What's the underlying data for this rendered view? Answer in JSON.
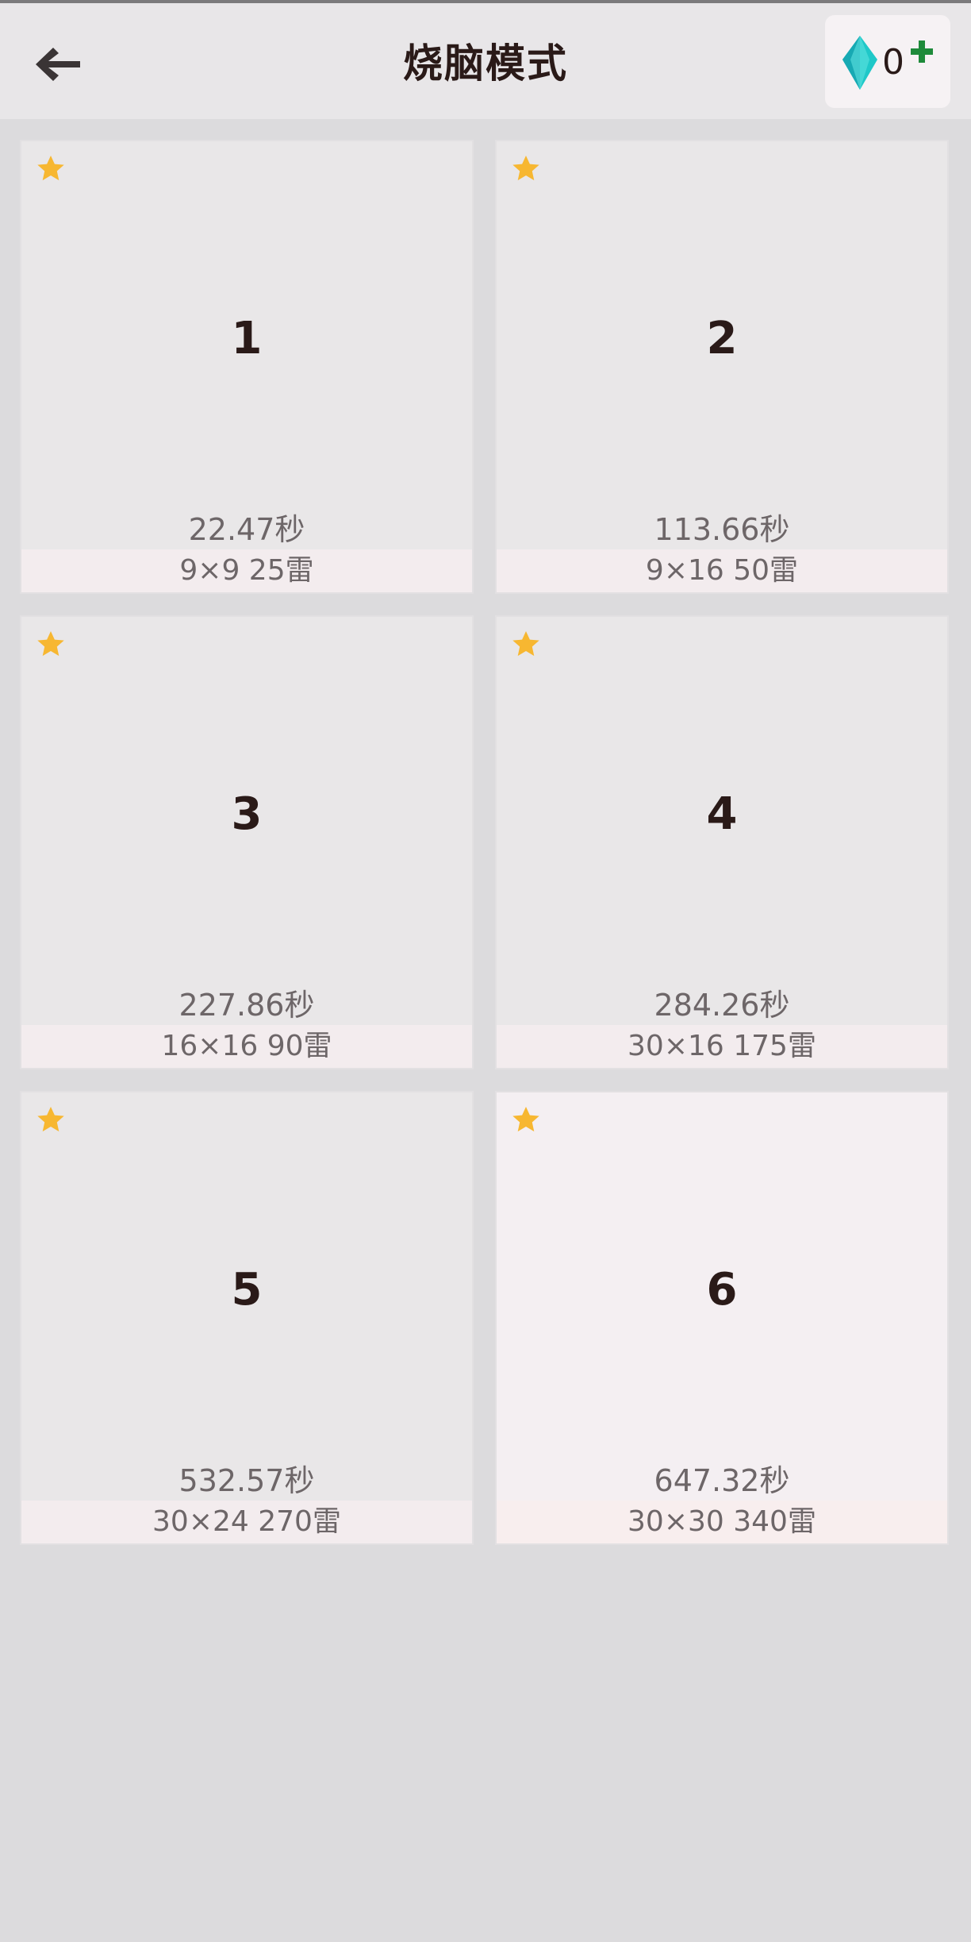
{
  "header": {
    "title": "烧脑模式",
    "gem_count": "0",
    "back_icon": "arrow-left-icon",
    "gem_icon": "diamond-icon",
    "plus_icon": "plus-icon"
  },
  "colors": {
    "star": "#f7b731",
    "gem": "#1fc8c8",
    "plus": "#1e8a3a"
  },
  "levels": [
    {
      "number": "1",
      "best_time": "22.47秒",
      "info": "9×9  25雷"
    },
    {
      "number": "2",
      "best_time": "113.66秒",
      "info": "9×16  50雷"
    },
    {
      "number": "3",
      "best_time": "227.86秒",
      "info": "16×16  90雷"
    },
    {
      "number": "4",
      "best_time": "284.26秒",
      "info": "30×16  175雷"
    },
    {
      "number": "5",
      "best_time": "532.57秒",
      "info": "30×24  270雷"
    },
    {
      "number": "6",
      "best_time": "647.32秒",
      "info": "30×30  340雷"
    }
  ]
}
